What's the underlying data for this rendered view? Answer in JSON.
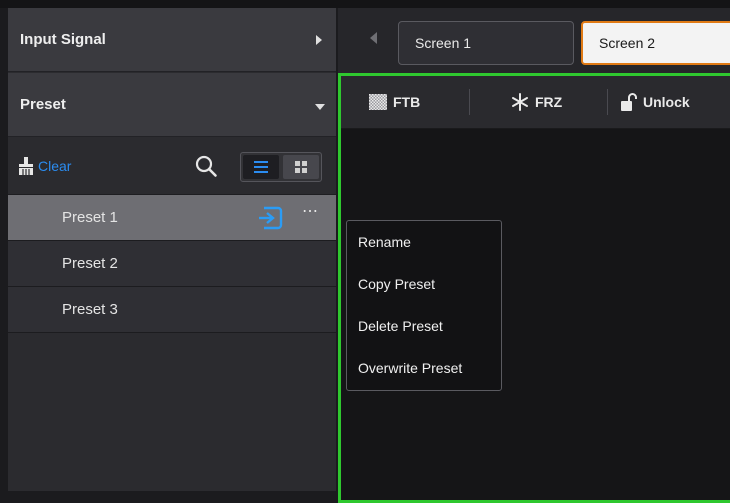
{
  "left_panel": {
    "input_signal": {
      "label": "Input Signal"
    },
    "preset": {
      "label": "Preset"
    },
    "toolbar": {
      "clear_label": "Clear"
    },
    "presets": [
      {
        "label": "Preset 1"
      },
      {
        "label": "Preset 2"
      },
      {
        "label": "Preset 3"
      }
    ],
    "more_label": "⋯"
  },
  "screens": {
    "tabs": [
      {
        "label": "Screen 1"
      },
      {
        "label": "Screen 2"
      }
    ]
  },
  "stage_toolbar": {
    "ftb": "FTB",
    "frz": "FRZ",
    "unlock": "Unlock"
  },
  "context_menu": {
    "items": [
      {
        "label": "Rename"
      },
      {
        "label": "Copy Preset"
      },
      {
        "label": "Delete Preset"
      },
      {
        "label": "Overwrite Preset"
      }
    ]
  },
  "colors": {
    "accent_blue": "#2b8cf0",
    "active_tab_border": "#e07a14",
    "stage_border": "#2fc82f"
  },
  "icons": [
    "broom-icon",
    "search-icon",
    "list-view-icon",
    "grid-view-icon",
    "recall-icon",
    "more-icon",
    "ftb-icon",
    "snowflake-icon",
    "unlock-icon"
  ]
}
